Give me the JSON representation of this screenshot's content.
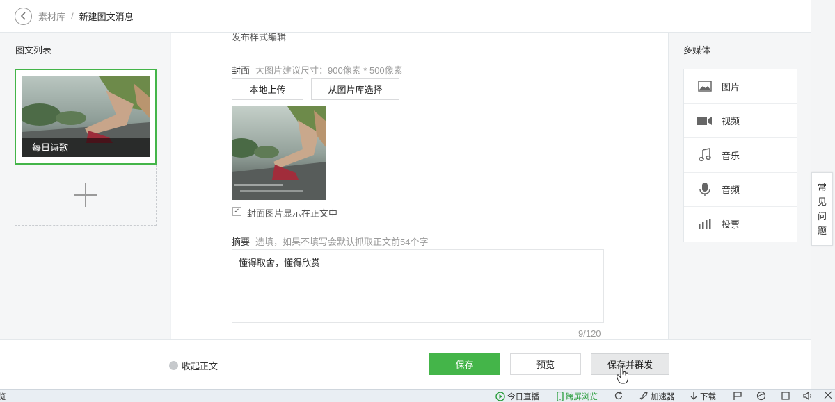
{
  "breadcrumb": {
    "back_icon": "chevron-left-icon",
    "parent": "素材库",
    "separator": "/",
    "current": "新建图文消息"
  },
  "left_panel": {
    "title": "图文列表",
    "articles": [
      {
        "caption": "每日诗歌"
      }
    ],
    "add_icon": "plus-icon"
  },
  "editor": {
    "section_title_cut": "发布样式编辑",
    "cover": {
      "label": "封面",
      "hint": "大图片建议尺寸：900像素 * 500像素",
      "upload_button": "本地上传",
      "library_button": "从图片库选择",
      "show_in_body_checked": true,
      "show_in_body_label": "封面图片显示在正文中"
    },
    "summary": {
      "label": "摘要",
      "hint": "选填，如果不填写会默认抓取正文前54个字",
      "value": "懂得取舍，懂得欣赏",
      "count": "9/120"
    }
  },
  "right_panel": {
    "title": "多媒体",
    "items": [
      {
        "label": "图片",
        "icon": "image-icon"
      },
      {
        "label": "视频",
        "icon": "video-icon"
      },
      {
        "label": "音乐",
        "icon": "music-icon"
      },
      {
        "label": "音频",
        "icon": "microphone-icon"
      },
      {
        "label": "投票",
        "icon": "vote-chart-icon"
      }
    ]
  },
  "faq_tab": {
    "label": "常见问题"
  },
  "bottom_bar": {
    "collapse_label": "收起正文",
    "save_label": "保存",
    "preview_label": "预览",
    "publish_label": "保存并群发"
  },
  "status_bar": {
    "left_fragment": "览",
    "items": [
      {
        "label": "今日直播",
        "icon": "play-circle-icon"
      },
      {
        "label": "跨屏浏览",
        "icon": "phone-icon"
      },
      {
        "label": "",
        "icon": "refresh-icon"
      },
      {
        "label": "加速器",
        "icon": "rocket-icon"
      },
      {
        "label": "下载",
        "icon": "download-icon"
      },
      {
        "label": "",
        "icon": "flag-icon"
      },
      {
        "label": "",
        "icon": "browser-icon"
      },
      {
        "label": "",
        "icon": "window-icon"
      },
      {
        "label": "",
        "icon": "volume-icon"
      },
      {
        "label": "",
        "icon": "expand-icon"
      }
    ]
  },
  "colors": {
    "accent_green": "#44b549",
    "panel_bg": "#f5f6f7",
    "border": "#e4e8eb"
  }
}
